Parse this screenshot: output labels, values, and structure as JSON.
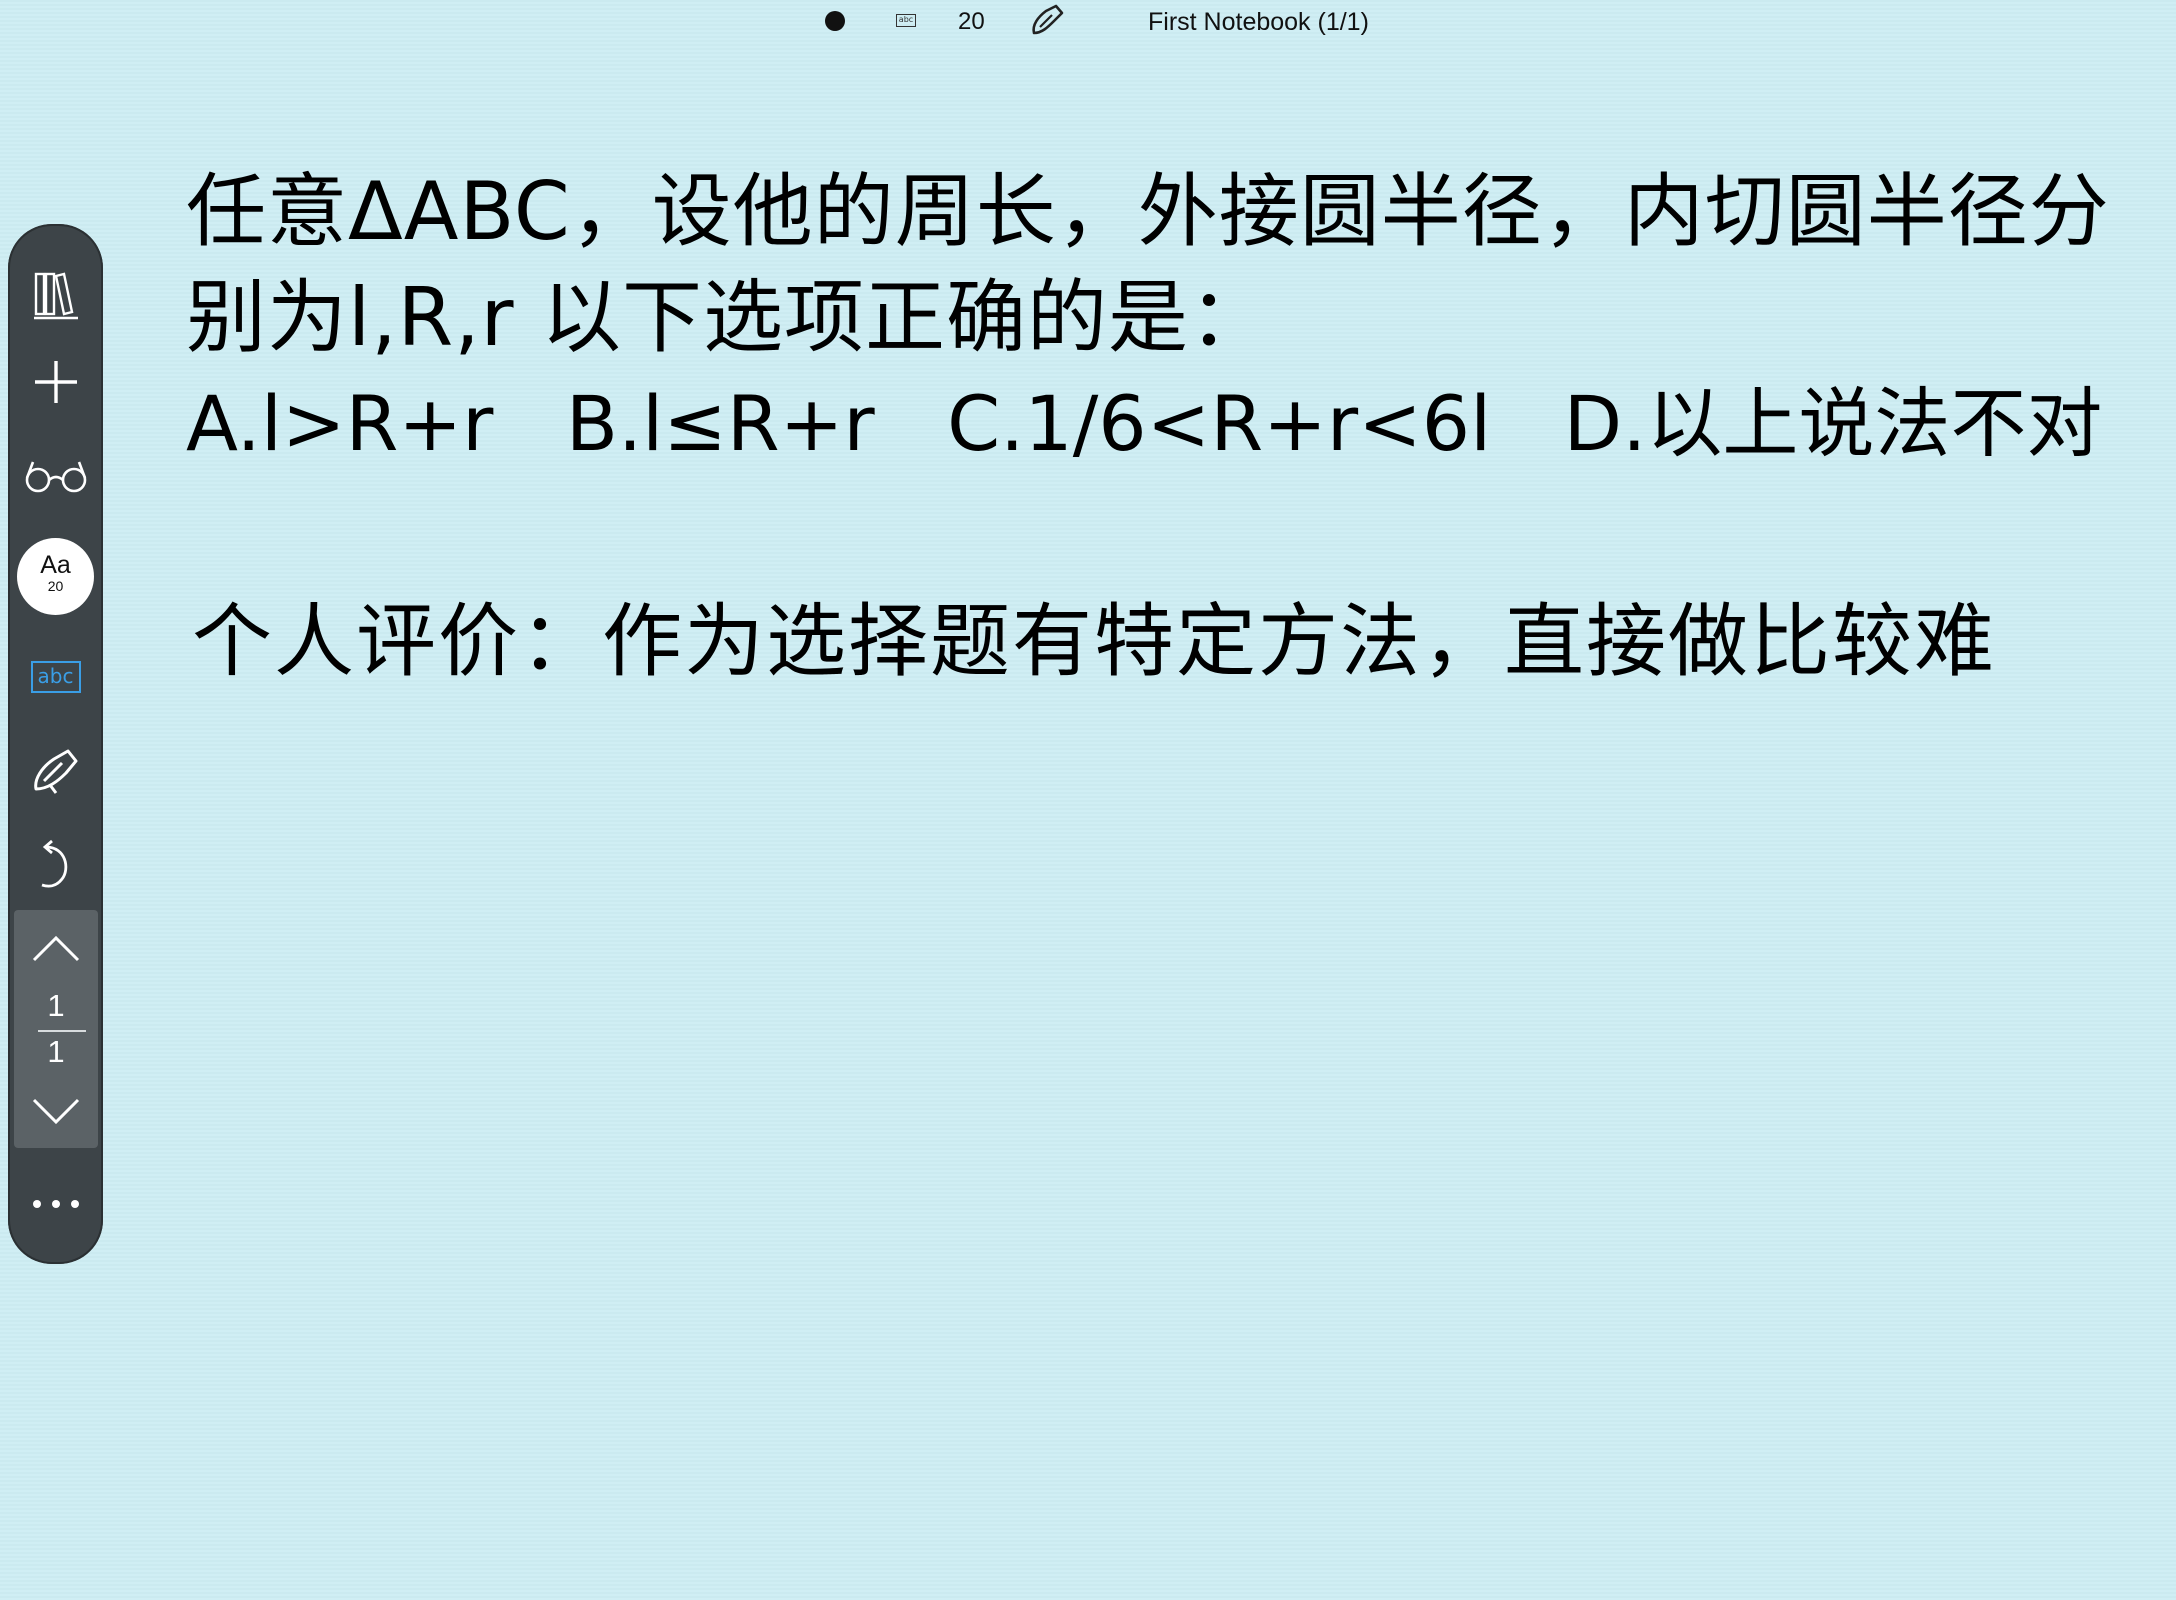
{
  "status_bar": {
    "pen_color_icon": "filled-circle",
    "text_mode_icon": "abc-icon",
    "font_size": "20",
    "pen_icon": "pen-icon",
    "notebook_title": "First Notebook (1/1)"
  },
  "toolbar": {
    "items": [
      {
        "name": "library-icon"
      },
      {
        "name": "add-icon"
      },
      {
        "name": "reading-glasses-icon"
      },
      {
        "name": "font-size-button"
      },
      {
        "name": "text-box-icon"
      },
      {
        "name": "pen-icon"
      },
      {
        "name": "undo-icon"
      },
      {
        "name": "more-icon"
      }
    ],
    "font_button": {
      "label": "Aa",
      "size": "20"
    },
    "abc_label": "abc",
    "pager": {
      "current": "1",
      "total": "1"
    },
    "more_label": "• • •"
  },
  "document": {
    "question_line1": "任意ΔABC，设他的周长，外接圆半径，内切圆半径分",
    "question_line2": "别为l,R,r 以下选项正确的是：",
    "options_line": "A.l>R+r   B.l≤R+r   C.1/6<R+r<6l   D.以上说法不对",
    "comment_line": "个人评价：作为选择题有特定方法，直接做比较难"
  },
  "colors": {
    "background": "#cdedf3",
    "toolbar": "#3d4448",
    "accent": "#3a9ee6"
  }
}
